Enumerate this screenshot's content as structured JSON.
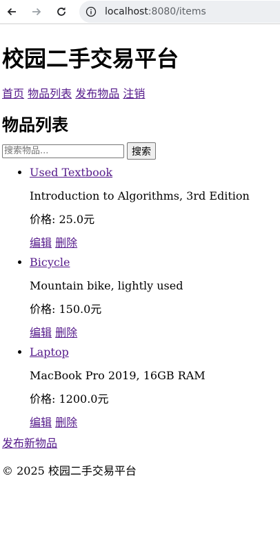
{
  "browser": {
    "url_host": "localhost",
    "url_path": ":8080/items"
  },
  "site": {
    "title": "校园二手交易平台",
    "nav": [
      "首页",
      "物品列表",
      "发布物品",
      "注销"
    ]
  },
  "page": {
    "heading": "物品列表",
    "search": {
      "placeholder": "搜索物品...",
      "button": "搜索"
    },
    "items": [
      {
        "name": "Used Textbook",
        "description": "Introduction to Algorithms, 3rd Edition",
        "price": "价格: 25.0元",
        "edit": "编辑",
        "delete": "删除"
      },
      {
        "name": "Bicycle",
        "description": "Mountain bike, lightly used",
        "price": "价格: 150.0元",
        "edit": "编辑",
        "delete": "删除"
      },
      {
        "name": "Laptop",
        "description": "MacBook Pro 2019, 16GB RAM",
        "price": "价格: 1200.0元",
        "edit": "编辑",
        "delete": "删除"
      }
    ],
    "add_new": "发布新物品"
  },
  "footer": {
    "text": "© 2025 校园二手交易平台"
  }
}
